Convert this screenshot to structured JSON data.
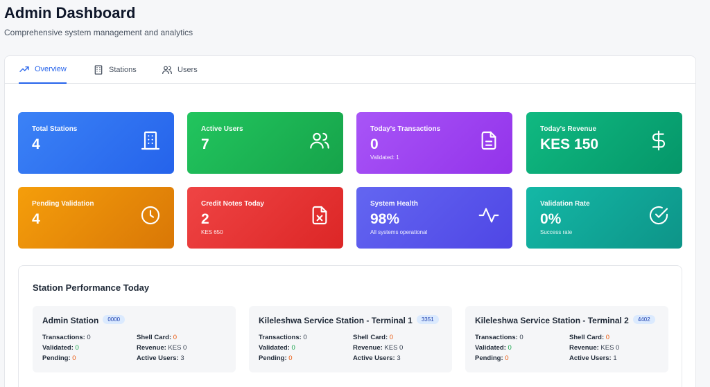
{
  "header": {
    "title": "Admin Dashboard",
    "subtitle": "Comprehensive system management and analytics"
  },
  "tabs": [
    {
      "label": "Overview",
      "icon": "trending-up-icon",
      "active": true
    },
    {
      "label": "Stations",
      "icon": "building-icon",
      "active": false
    },
    {
      "label": "Users",
      "icon": "users-icon",
      "active": false
    }
  ],
  "cards": [
    {
      "label": "Total Stations",
      "value": "4",
      "sub": "",
      "icon": "building-icon",
      "color": "#2563eb"
    },
    {
      "label": "Active Users",
      "value": "7",
      "sub": "",
      "icon": "users-icon",
      "color": "#16a34a"
    },
    {
      "label": "Today's Transactions",
      "value": "0",
      "sub": "Validated: 1",
      "icon": "document-icon",
      "color": "#9333ea"
    },
    {
      "label": "Today's Revenue",
      "value": "KES 150",
      "sub": "",
      "icon": "dollar-icon",
      "color": "#059669"
    },
    {
      "label": "Pending Validation",
      "value": "4",
      "sub": "",
      "icon": "clock-icon",
      "color": "#ea580c"
    },
    {
      "label": "Credit Notes Today",
      "value": "2",
      "sub": "KES 650",
      "icon": "file-x-icon",
      "color": "#dc2626"
    },
    {
      "label": "System Health",
      "value": "98%",
      "sub": "All systems operational",
      "icon": "activity-icon",
      "color": "#4f46e5"
    },
    {
      "label": "Validation Rate",
      "value": "0%",
      "sub": "Success rate",
      "icon": "check-circle-icon",
      "color": "#0d9488"
    }
  ],
  "performance": {
    "title": "Station Performance Today",
    "labels": {
      "transactions": "Transactions:",
      "validated": "Validated:",
      "pending": "Pending:",
      "shell_card": "Shell Card:",
      "revenue": "Revenue:",
      "active_users": "Active Users:"
    },
    "stations": [
      {
        "name": "Admin Station",
        "code": "0000",
        "transactions": "0",
        "validated": "0",
        "pending": "0",
        "shell_card": "0",
        "revenue": "KES 0",
        "active_users": "3"
      },
      {
        "name": "Kileleshwa Service Station - Terminal 1",
        "code": "3351",
        "transactions": "0",
        "validated": "0",
        "pending": "0",
        "shell_card": "0",
        "revenue": "KES 0",
        "active_users": "3"
      },
      {
        "name": "Kileleshwa Service Station - Terminal 2",
        "code": "4402",
        "transactions": "0",
        "validated": "0",
        "pending": "0",
        "shell_card": "0",
        "revenue": "KES 0",
        "active_users": "1"
      }
    ]
  }
}
